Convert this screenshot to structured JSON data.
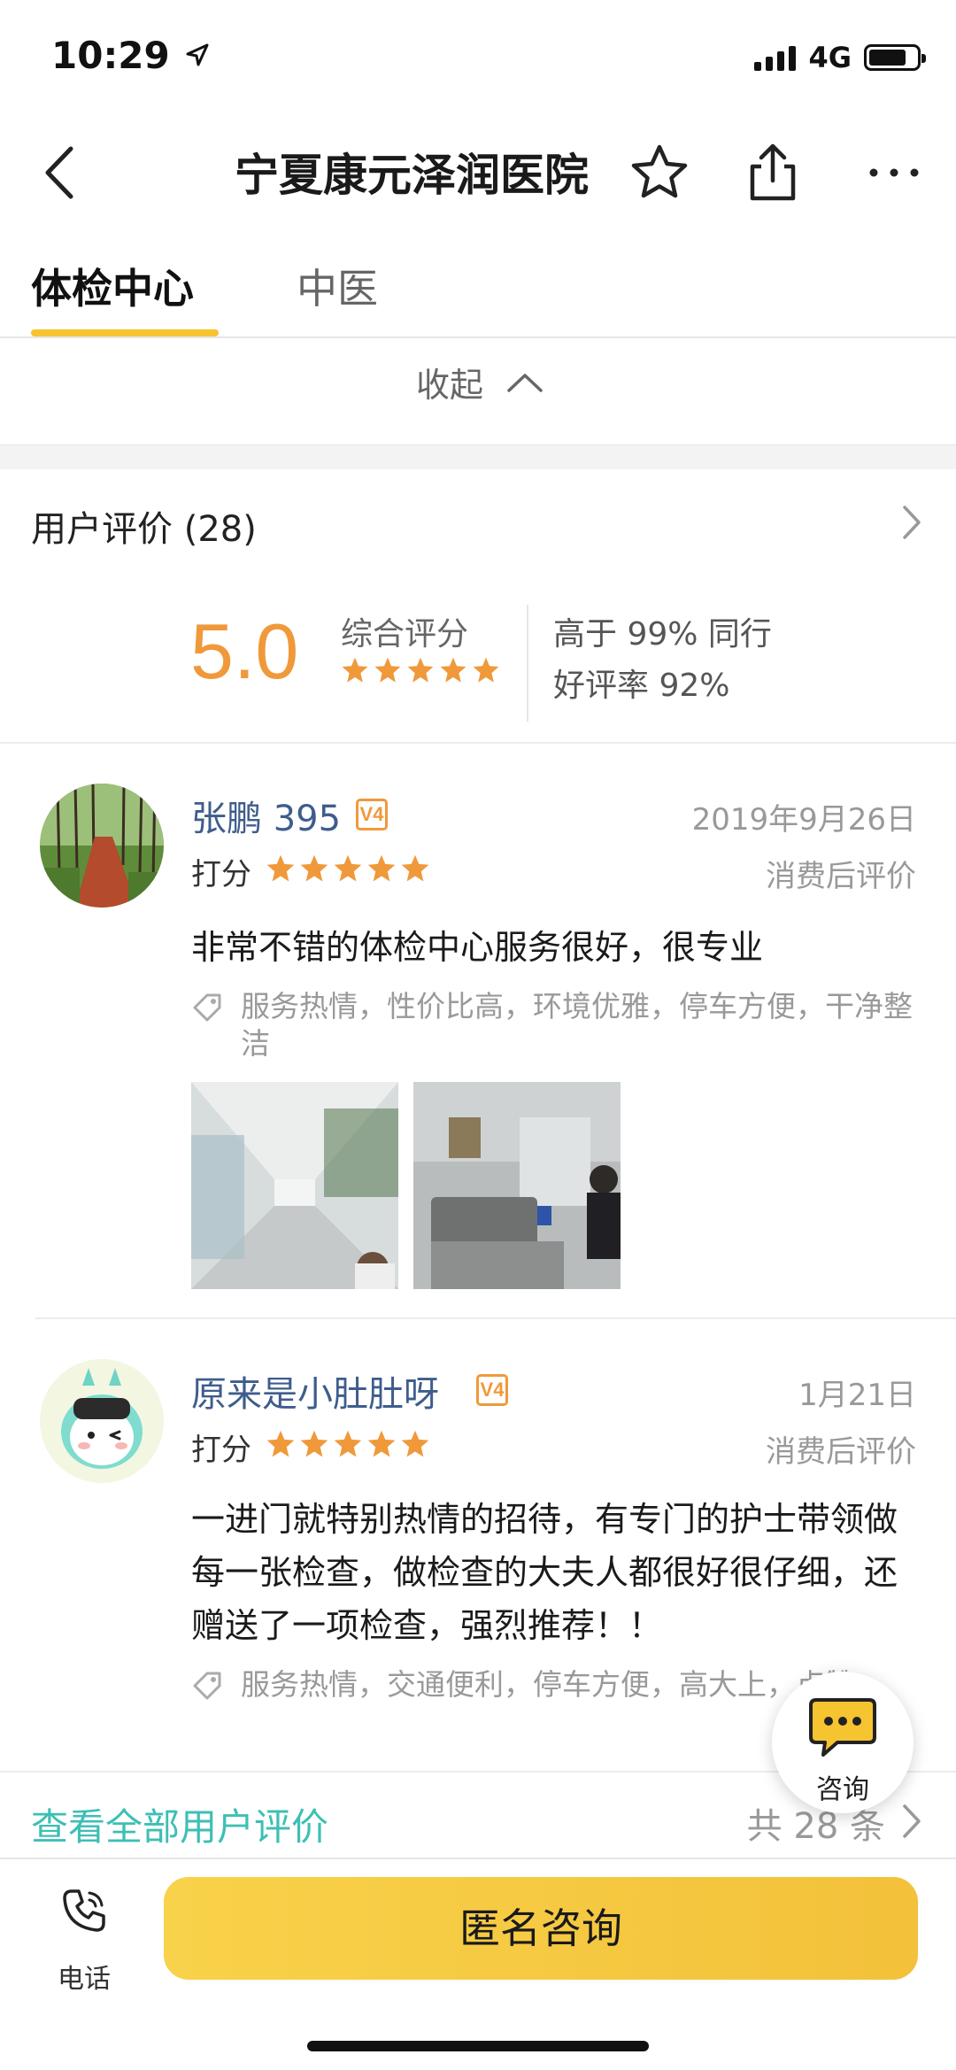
{
  "status_bar": {
    "time": "10:29",
    "network": "4G"
  },
  "nav": {
    "title": "宁夏康元泽润医院"
  },
  "tabs": [
    {
      "label": "体检中心"
    },
    {
      "label": "中医"
    }
  ],
  "collapse": {
    "label": "收起"
  },
  "reviews_header": {
    "title": "用户评价 (28)"
  },
  "score": {
    "value": "5.0",
    "label": "综合评分",
    "stars": 5,
    "stat1": "高于 99% 同行",
    "stat2": "好评率 92%"
  },
  "reviews": [
    {
      "user": "张鹏 395",
      "badge": "V4",
      "date": "2019年9月26日",
      "score_label": "打分",
      "stars": 5,
      "after_label": "消费后评价",
      "text": "非常不错的体检中心服务很好，很专业",
      "tags": "服务热情，性价比高，环境优雅，停车方便，干净整洁"
    },
    {
      "user": "原来是小肚肚呀",
      "badge": "V4",
      "date": "1月21日",
      "score_label": "打分",
      "stars": 5,
      "after_label": "消费后评价",
      "text": "一进门就特别热情的招待，有专门的护士带领做每一张检查，做检查的大夫人都很好很仔细，还赠送了一项检查，强烈推荐！！",
      "tags": "服务热情，交通便利，停车方便，高大上，点赞"
    }
  ],
  "view_all": {
    "label": "查看全部用户评价",
    "count": "共 28 条"
  },
  "float_consult": {
    "label": "咨询"
  },
  "bottom": {
    "phone_label": "电话",
    "consult_label": "匿名咨询"
  },
  "colors": {
    "accent_yellow": "#f6c431",
    "score_orange": "#f0993b",
    "link_teal": "#3dbfb4",
    "username_blue": "#3e5d8c"
  }
}
